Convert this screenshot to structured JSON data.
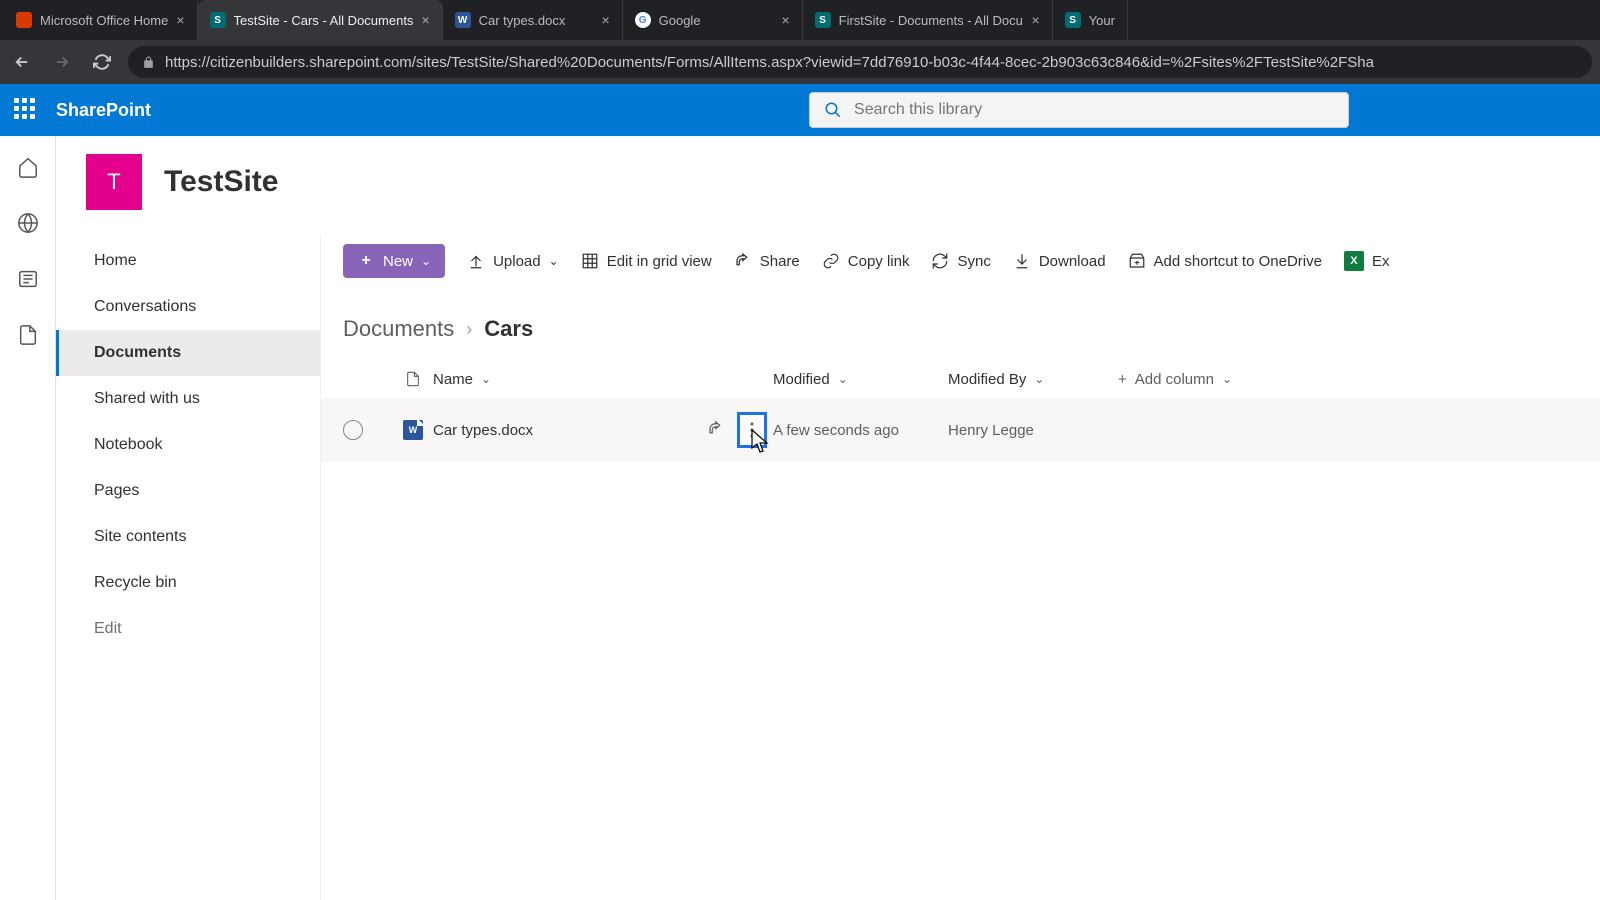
{
  "browser": {
    "tabs": [
      {
        "title": "Microsoft Office Home",
        "favicon": "office"
      },
      {
        "title": "TestSite - Cars - All Documents",
        "favicon": "sp",
        "active": true
      },
      {
        "title": "Car types.docx",
        "favicon": "word"
      },
      {
        "title": "Google",
        "favicon": "google"
      },
      {
        "title": "FirstSite - Documents - All Docu",
        "favicon": "sp"
      },
      {
        "title": "Your",
        "favicon": "sp"
      }
    ],
    "url": "https://citizenbuilders.sharepoint.com/sites/TestSite/Shared%20Documents/Forms/AllItems.aspx?viewid=7dd76910-b03c-4f44-8cec-2b903c63c846&id=%2Fsites%2FTestSite%2FSha"
  },
  "suite": {
    "product": "SharePoint",
    "search_placeholder": "Search this library"
  },
  "site": {
    "logo_letter": "T",
    "title": "TestSite"
  },
  "nav": {
    "items": [
      {
        "label": "Home"
      },
      {
        "label": "Conversations"
      },
      {
        "label": "Documents",
        "active": true
      },
      {
        "label": "Shared with us"
      },
      {
        "label": "Notebook"
      },
      {
        "label": "Pages"
      },
      {
        "label": "Site contents"
      },
      {
        "label": "Recycle bin"
      }
    ],
    "edit_label": "Edit"
  },
  "commands": {
    "new": "New",
    "upload": "Upload",
    "edit_grid": "Edit in grid view",
    "share": "Share",
    "copy_link": "Copy link",
    "sync": "Sync",
    "download": "Download",
    "shortcut": "Add shortcut to OneDrive",
    "excel_export": "Ex"
  },
  "breadcrumb": {
    "root": "Documents",
    "leaf": "Cars"
  },
  "columns": {
    "name": "Name",
    "modified": "Modified",
    "modified_by": "Modified By",
    "add": "Add column"
  },
  "rows": [
    {
      "name": "Car types.docx",
      "modified": "A few seconds ago",
      "modified_by": "Henry Legge"
    }
  ]
}
